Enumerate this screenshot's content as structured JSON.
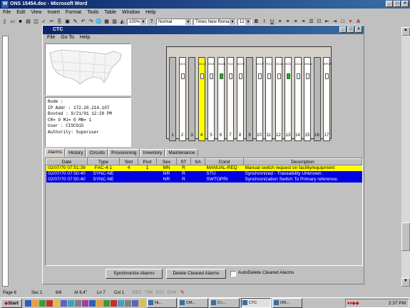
{
  "word": {
    "title": "ONS 15454.doc - Microsoft Word",
    "menu": [
      "File",
      "Edit",
      "View",
      "Insert",
      "Format",
      "Tools",
      "Table",
      "Window",
      "Help"
    ],
    "zoom": "100%",
    "style": "Normal",
    "font": "Times New Roman",
    "size": "12"
  },
  "ctc": {
    "title": "CTC",
    "menu": [
      "File",
      "Go To",
      "Help"
    ],
    "info": {
      "node": "Node      :",
      "ip": "IP Addr  : 172.20.214.107",
      "booted": "Booted : 9/21/01 12:28 PM",
      "alarms": "CR= 0 MJ= 0 MN= 1",
      "user": "User     : CISCO15",
      "authority": "Authority: Superuser"
    },
    "slots": [
      {
        "n": "1",
        "l": "",
        "t": "blank"
      },
      {
        "n": "2",
        "l": "OC3",
        "t": "card"
      },
      {
        "n": "3",
        "l": "",
        "t": "blank"
      },
      {
        "n": "4",
        "l": "OC12",
        "t": "sel"
      },
      {
        "n": "5",
        "l": "OC3",
        "t": "card"
      },
      {
        "n": "6",
        "l": "OC48",
        "t": "card"
      },
      {
        "n": "7",
        "l": "TCC",
        "t": "card"
      },
      {
        "n": "8",
        "l": "XCVT",
        "t": "card"
      },
      {
        "n": "9",
        "l": "",
        "t": "blank"
      },
      {
        "n": "10",
        "l": "XCVT",
        "t": "card"
      },
      {
        "n": "11",
        "l": "TCC",
        "t": "card"
      },
      {
        "n": "12",
        "l": "OC48",
        "t": "card"
      },
      {
        "n": "13",
        "l": "EO1",
        "t": "card"
      },
      {
        "n": "14",
        "l": "OC12",
        "t": "card"
      },
      {
        "n": "15",
        "l": "DS1N",
        "t": "card"
      },
      {
        "n": "16",
        "l": "",
        "t": "blank"
      },
      {
        "n": "17",
        "l": "EPOS",
        "t": "card"
      }
    ],
    "tabs": [
      "Alarms",
      "History",
      "Circuits",
      "Provisioning",
      "Inventory",
      "Maintenance"
    ],
    "columns": [
      "Date",
      "Type",
      "Slot",
      "Port",
      "Sev",
      "ST",
      "SA",
      "Cond",
      "Description"
    ],
    "rows": [
      {
        "date": "02/07/70 07:51:39",
        "type": "FAC-4-1",
        "slot": "4",
        "port": "1",
        "sev": "MN",
        "st": "R",
        "sa": "",
        "cond": "MANUAL-REQ",
        "desc": "Manual switch request on facility/equipment",
        "c": "yellow"
      },
      {
        "date": "02/07/70 07:50:40",
        "type": "SYNC-NE",
        "slot": "",
        "port": "",
        "sev": "NR",
        "st": "R",
        "sa": "",
        "cond": "STU",
        "desc": "Synchronized - Traceability Unknown.",
        "c": "blue"
      },
      {
        "date": "02/07/70 07:50:40",
        "type": "SYNC-NE",
        "slot": "",
        "port": "",
        "sev": "NR",
        "st": "R",
        "sa": "",
        "cond": "SWTOPRI",
        "desc": "Synchronization Switch To Primary reference.",
        "c": "blue"
      }
    ],
    "buttons": {
      "sync": "Synchronize Alarms",
      "delete": "Delete Cleared Alarms",
      "auto": "AutoDelete Cleared Alarms"
    }
  },
  "status": {
    "page": "Page  6",
    "sec": "Sec  1",
    "pages": "6/6",
    "at": "At  6.4\"",
    "ln": "Ln  7",
    "col": "Col  1",
    "rec": "REC",
    "trk": "TRK",
    "ext": "EXT",
    "ovr": "OVR"
  },
  "taskbar": {
    "start": "Start",
    "tasks": [
      "Nt...",
      "CM...",
      "C:\\...",
      "CTC",
      "ON..."
    ],
    "time": "2:37 PM"
  }
}
